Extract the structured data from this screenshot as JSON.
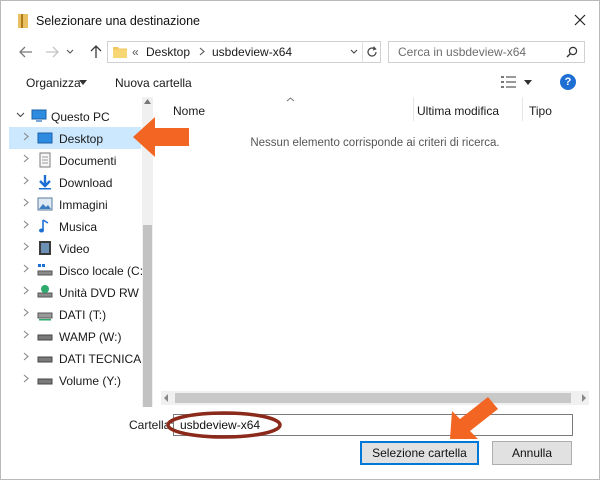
{
  "window": {
    "title": "Selezionare una destinazione",
    "close_glyph": "✕"
  },
  "address": {
    "overflow_glyph": "«",
    "crumbs": [
      "Desktop",
      "usbdeview-x64"
    ],
    "search_placeholder": "Cerca in usbdeview-x64"
  },
  "toolbar": {
    "organize_label": "Organizza",
    "new_folder_label": "Nuova cartella",
    "help_label": "?"
  },
  "tree": {
    "root": "Questo PC",
    "items": [
      {
        "label": "Desktop",
        "icon": "desktop-icon",
        "selected": true
      },
      {
        "label": "Documenti",
        "icon": "documents-icon"
      },
      {
        "label": "Download",
        "icon": "download-icon"
      },
      {
        "label": "Immagini",
        "icon": "pictures-icon"
      },
      {
        "label": "Musica",
        "icon": "music-icon"
      },
      {
        "label": "Video",
        "icon": "video-icon"
      },
      {
        "label": "Disco locale (C:)",
        "icon": "local-disk-icon"
      },
      {
        "label": "Unità DVD RW (L",
        "icon": "dvd-drive-icon"
      },
      {
        "label": "DATI  (T:)",
        "icon": "drive-icon"
      },
      {
        "label": "WAMP (W:)",
        "icon": "drive-icon"
      },
      {
        "label": "DATI TECNICA (",
        "icon": "drive-icon"
      },
      {
        "label": "Volume (Y:)",
        "icon": "drive-icon"
      }
    ]
  },
  "columns": {
    "name": "Nome",
    "modified": "Ultima modifica",
    "type": "Tipo"
  },
  "empty_message": "Nessun elemento corrisponde ai criteri di ricerca.",
  "footer": {
    "folder_label": "Cartella:",
    "folder_value": "usbdeview-x64",
    "select_button": "Selezione cartella",
    "cancel_button": "Annulla"
  },
  "colors": {
    "accent": "#0078d7",
    "selection": "#cce8ff",
    "annotation_arrow": "#f26522",
    "annotation_circle": "#8b2a1a"
  }
}
